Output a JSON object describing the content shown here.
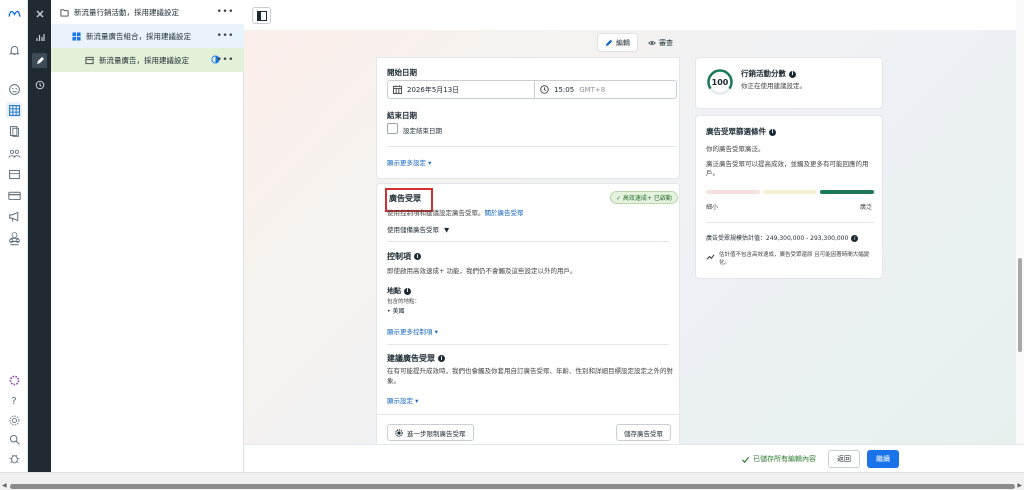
{
  "tree": {
    "campaign": "新流量行銷活動，採用建議設定",
    "adset": "新流量廣告組合，採用建議設定",
    "ad": "新流量廣告，採用建議設定",
    "more": "•••"
  },
  "modebar": {
    "edit": "編輯",
    "review": "審查"
  },
  "schedule": {
    "start_label": "開始日期",
    "start_date": "2026年5月13日",
    "start_time": "15:05",
    "timezone": "GMT+8",
    "end_label": "結束日期",
    "end_checkbox_label": "設定結束日期",
    "more_settings": "顯示更多設定 ▾"
  },
  "audience": {
    "title": "廣告受眾",
    "badge": "✓ 高效速成+ 已啟動",
    "desc": "使用控制項和建議設定廣告受眾。",
    "desc_link": "關於廣告受眾",
    "saved_audience": "使用儲備廣告受眾",
    "controls_title": "控制項",
    "controls_desc": "即使啟用高效速成+ 功能，我們仍不會觸及這些設定以外的用戶。",
    "location_title": "地點",
    "location_included": "包含的地點：",
    "location_value": "• 美國",
    "more_controls": "顯示更多控制項 ▾",
    "suggest_title": "建議廣告受眾",
    "suggest_desc": "在有可能提升成效時，我們也會觸及你套用自訂廣告受眾、年齡、性別和詳細目標設定設定之外的對象。",
    "show_settings": "顯示設定 ▾",
    "restrict_button": "進一步限制廣告受眾",
    "save_button": "儲存廣告受眾"
  },
  "score": {
    "value": "100",
    "title": "行銷活動分數",
    "subtitle": "你正在使用建議設定。"
  },
  "definition": {
    "title": "廣告受眾篩選條件",
    "line1": "你的廣告受眾廣泛。",
    "line2": "廣泛廣告受眾可以提高成效，並觸及更多有可能回應的用戶。",
    "narrow": "細小",
    "broad": "廣泛",
    "estimate": "廣告受眾規模估計值：249,300,000 - 293,300,000",
    "note": "估計值不包含高效速成，廣告受眾還原 且可能因著時間大幅變化。"
  },
  "footer": {
    "saved": "已儲存所有編輯內容",
    "back": "返回",
    "next": "繼續"
  },
  "colors": {
    "accent": "#1a73e8",
    "highlight": "#d32f2f",
    "score_ring": "#1b7a5a"
  }
}
